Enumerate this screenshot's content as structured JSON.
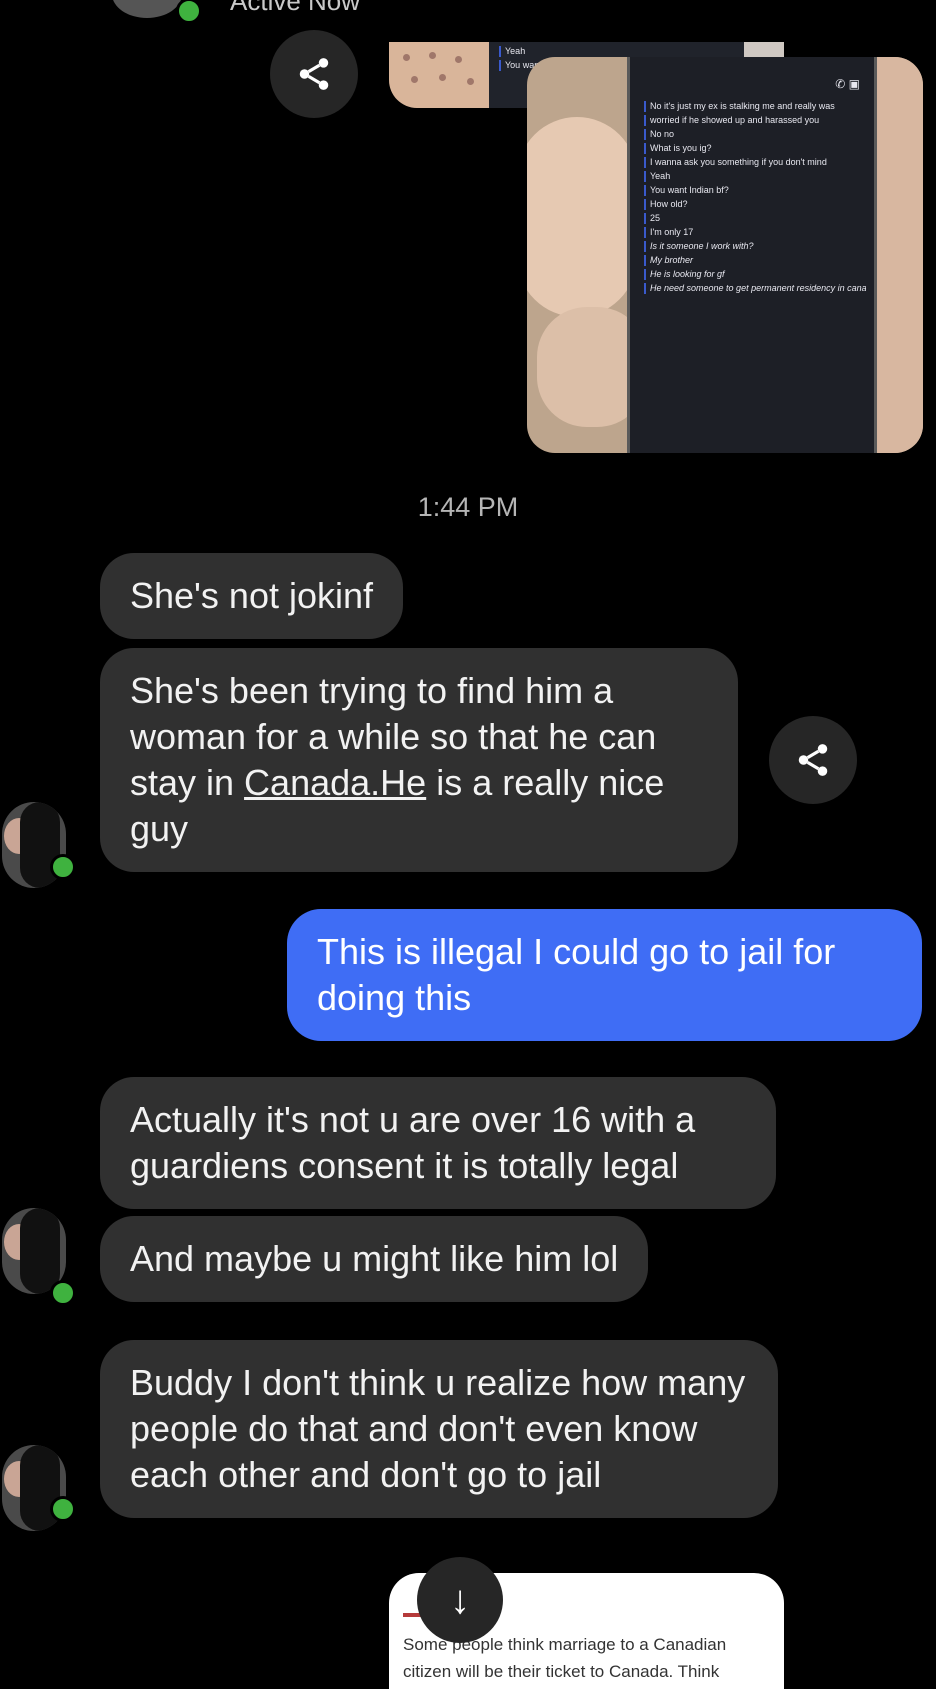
{
  "header": {
    "status": "Active Now"
  },
  "photo_top": {
    "lines": [
      "Yeah",
      "You want indian bf?"
    ]
  },
  "photo_main": {
    "phone_icons": "✆ ▣",
    "lines": [
      {
        "text": "No it's just my ex is stalking me and really was",
        "tag": ""
      },
      {
        "text": "worried if he showed up and harassed you",
        "tag": ""
      },
      {
        "text": "No no",
        "tag": ""
      },
      {
        "text": "What is you ig?",
        "tag": ""
      },
      {
        "text": "I wanna ask you something if you don't mind",
        "tag": ""
      },
      {
        "text": "Yeah",
        "tag": ""
      },
      {
        "text": "You want Indian bf?",
        "tag": ""
      },
      {
        "text": "How old?",
        "tag": ""
      },
      {
        "text": "25",
        "tag": ""
      },
      {
        "text": "I'm only 17",
        "tag": ""
      },
      {
        "text": "Is it someone I work with?",
        "tag": ""
      },
      {
        "text": "My brother",
        "tag": ""
      },
      {
        "text": "He is looking for gf",
        "tag": ""
      },
      {
        "text": "He need someone to get permanent residency in canada",
        "tag": ""
      }
    ]
  },
  "timestamp": "1:44 PM",
  "messages": {
    "m1": "She's not jokinf",
    "m2_before": "She's been trying to find him a woman for a while so that he can stay in ",
    "m2_link": "Canada.He",
    "m2_after": " is a really nice guy",
    "m3": "This is illegal I could go to jail for doing this",
    "m4": "Actually it's not u are over 16 with a guardiens consent it is totally legal",
    "m5": "And maybe u might like him lol",
    "m6": "Buddy I don't think u realize how many people do that and don't even know each other and don't go to jail"
  },
  "card": {
    "text": "Some people think marriage to a Canadian citizen will be their ticket to Canada. Think"
  },
  "icons": {
    "share": "share-icon",
    "scroll": "arrow-down-icon"
  },
  "colors": {
    "background": "#000000",
    "received_bubble": "#303030",
    "sent_bubble": "#3f6df5",
    "online": "#3fb23f"
  }
}
